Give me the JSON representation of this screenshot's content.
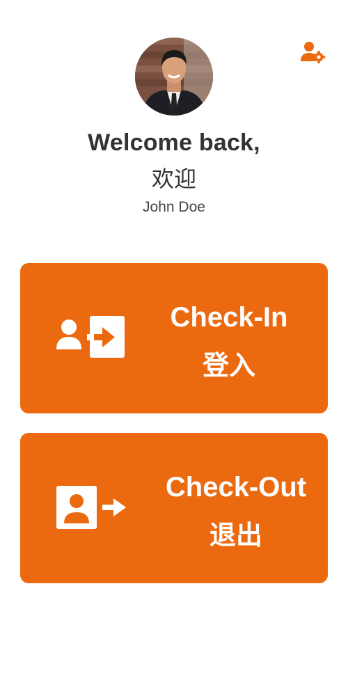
{
  "header": {
    "settings_icon": "user-settings-icon",
    "accent_color": "#ec6a0f"
  },
  "profile": {
    "avatar": "avatar-photo",
    "welcome_en": "Welcome back,",
    "welcome_zh": "欢迎",
    "name": "John Doe"
  },
  "actions": {
    "checkin": {
      "icon": "user-sign-in-icon",
      "label_en": "Check-In",
      "label_zh": "登入"
    },
    "checkout": {
      "icon": "user-exit-icon",
      "label_en": "Check-Out",
      "label_zh": "退出"
    }
  }
}
